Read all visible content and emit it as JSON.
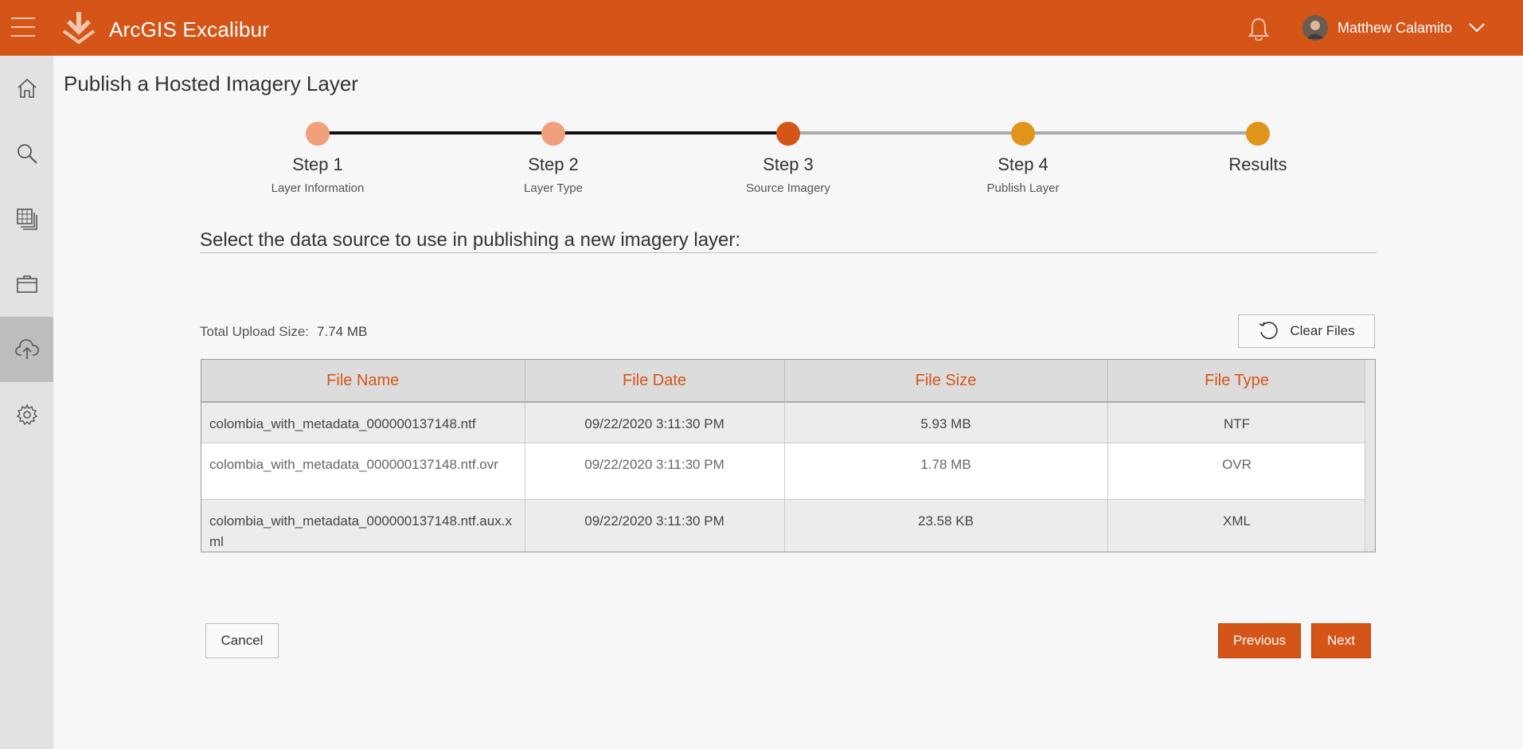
{
  "header": {
    "app_title": "ArcGIS Excalibur",
    "user_name": "Matthew Calamito",
    "icons": [
      "hamburger-menu-icon",
      "excalibur-logo-icon",
      "bell-icon",
      "avatar",
      "chevron-down-icon"
    ]
  },
  "sidebar": {
    "items": [
      {
        "name": "home",
        "icon": "home-icon"
      },
      {
        "name": "search",
        "icon": "search-icon"
      },
      {
        "name": "catalog",
        "icon": "imagery-catalog-icon"
      },
      {
        "name": "projects",
        "icon": "briefcase-icon"
      },
      {
        "name": "upload",
        "icon": "cloud-upload-icon",
        "active": true
      },
      {
        "name": "settings",
        "icon": "gear-icon"
      }
    ]
  },
  "page": {
    "title": "Publish a Hosted Imagery Layer",
    "prompt": "Select the data source to use in publishing a new imagery layer:"
  },
  "stepper": {
    "steps": [
      {
        "label": "Step 1",
        "sub": "Layer Information",
        "state": "done"
      },
      {
        "label": "Step 2",
        "sub": "Layer Type",
        "state": "done"
      },
      {
        "label": "Step 3",
        "sub": "Source Imagery",
        "state": "current"
      },
      {
        "label": "Step 4",
        "sub": "Publish Layer",
        "state": "todo"
      },
      {
        "label": "Results",
        "sub": "",
        "state": "todo"
      }
    ],
    "colors": {
      "done": "#f0a07a",
      "current": "#d55519",
      "todo": "#e0951a",
      "line_done": "#111111",
      "line_todo": "#aaaaaa"
    }
  },
  "upload": {
    "total_label": "Total Upload Size:",
    "total_value": "7.74 MB",
    "clear_label": "Clear Files"
  },
  "table": {
    "headers": [
      "File Name",
      "File Date",
      "File Size",
      "File Type"
    ],
    "rows": [
      {
        "name": "colombia_with_metadata_000000137148.ntf",
        "date": "09/22/2020 3:11:30 PM",
        "size": "5.93 MB",
        "type": "NTF"
      },
      {
        "name": "colombia_with_metadata_000000137148.ntf.ovr",
        "date": "09/22/2020 3:11:30 PM",
        "size": "1.78 MB",
        "type": "OVR"
      },
      {
        "name": "colombia_with_metadata_000000137148.ntf.aux.xml",
        "date": "09/22/2020 3:11:30 PM",
        "size": "23.58 KB",
        "type": "XML"
      }
    ]
  },
  "footer": {
    "cancel_label": "Cancel",
    "previous_label": "Previous",
    "next_label": "Next"
  },
  "colors": {
    "accent": "#d55519",
    "sidebar": "#e2e2e2",
    "sidebar_active": "#bdbdbd"
  }
}
